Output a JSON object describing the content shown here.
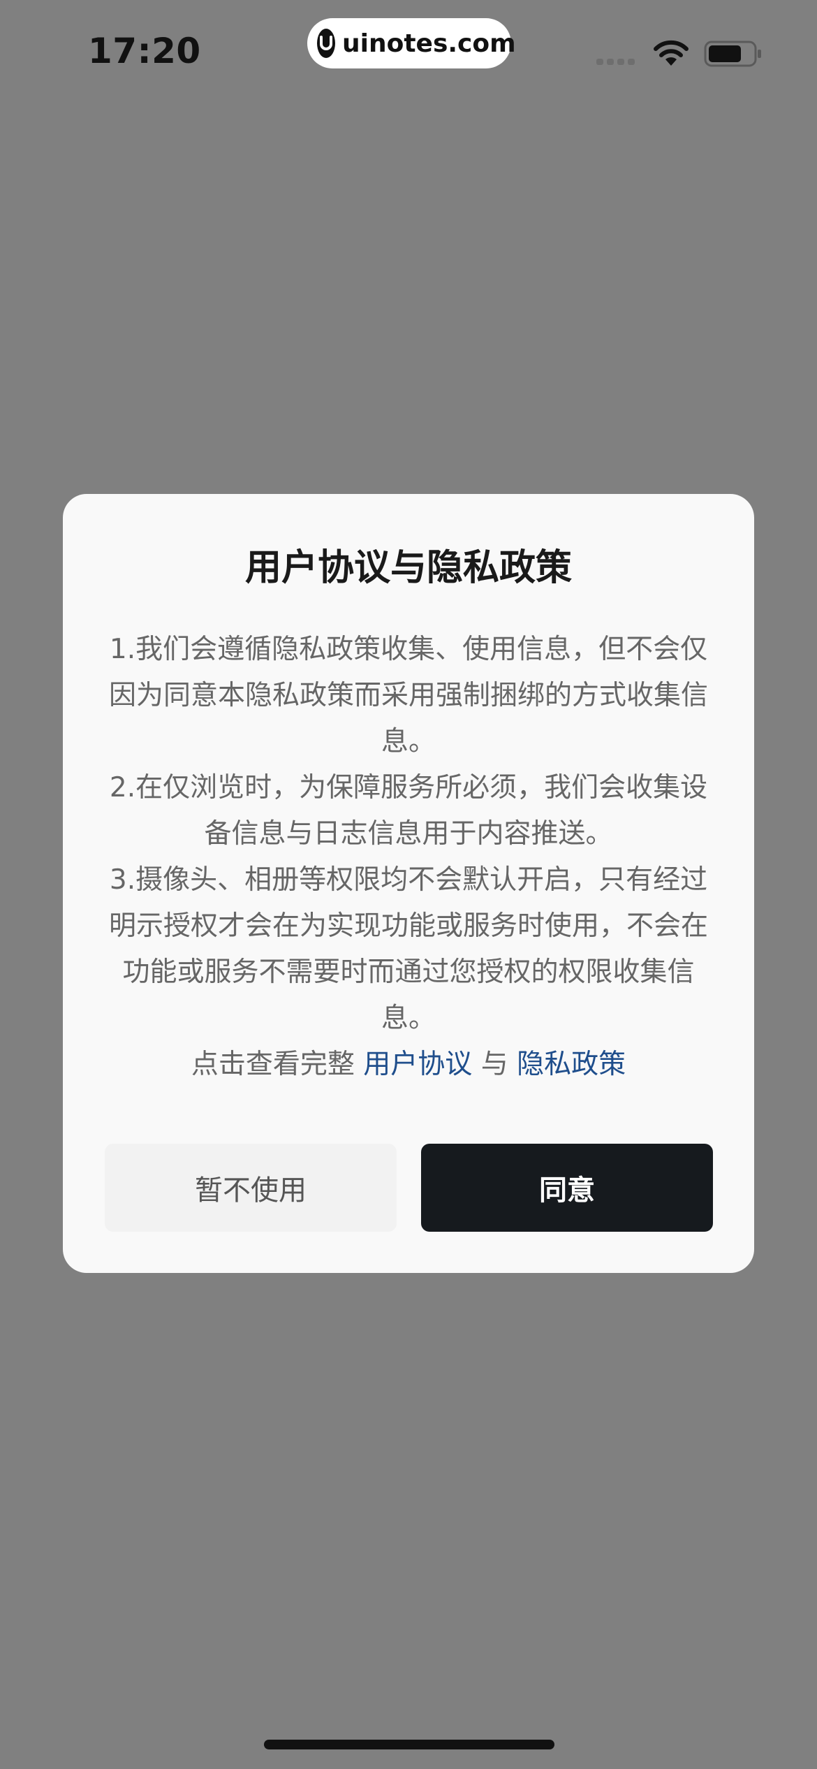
{
  "status_bar": {
    "time": "17:20",
    "watermark": "uinotes.com",
    "icons": [
      "cellular-signal-icon",
      "wifi-icon",
      "battery-icon"
    ]
  },
  "dialog": {
    "title": "用户协议与隐私政策",
    "paragraphs": [
      "1.我们会遵循隐私政策收集、使用信息，但不会仅因为同意本隐私政策而采用强制捆绑的方式收集信息。",
      "2.在仅浏览时，为保障服务所必须，我们会收集设备信息与日志信息用于内容推送。",
      "3.摄像头、相册等权限均不会默认开启，只有经过明示授权才会在为实现功能或服务时使用，不会在功能或服务不需要时而通过您授权的权限收集信息。"
    ],
    "links_line": {
      "prefix": "点击查看完整",
      "user_agreement": "用户协议",
      "conjunction": "与",
      "privacy_policy": "隐私政策"
    },
    "buttons": {
      "decline": "暂不使用",
      "agree": "同意"
    }
  },
  "colors": {
    "overlay": "#808080",
    "dialog_bg": "#f9f9f9",
    "link": "#1f4e8c",
    "agree_bg": "#161a1e",
    "decline_bg": "#f2f2f2"
  }
}
